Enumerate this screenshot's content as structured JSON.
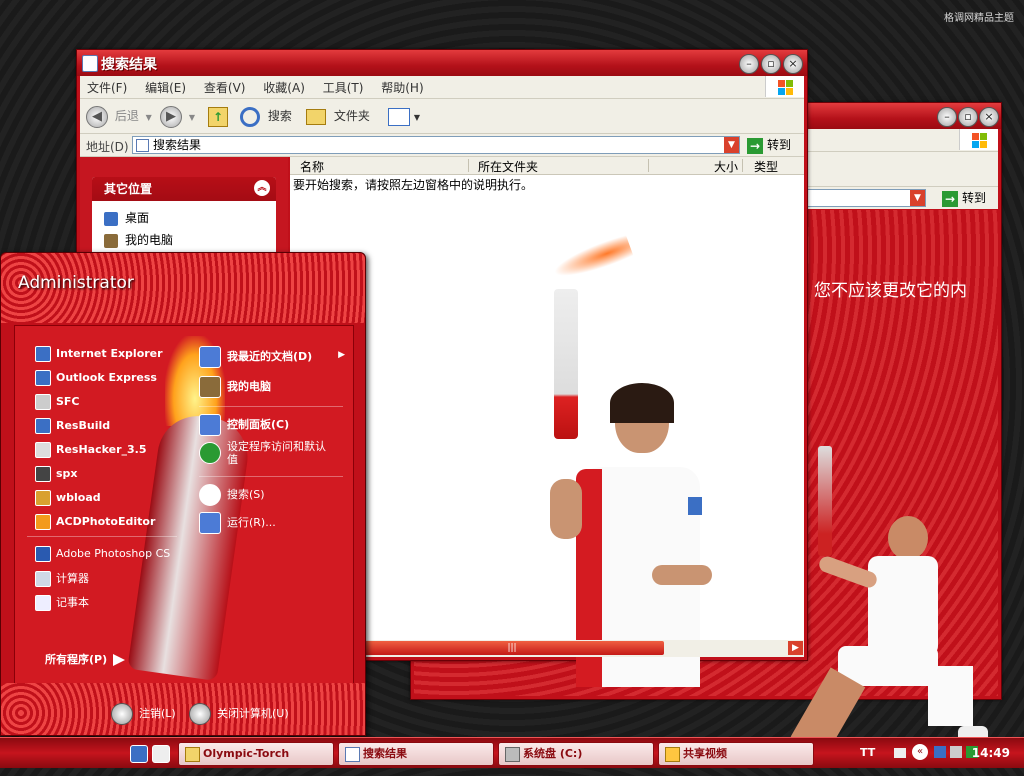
{
  "desktop": {
    "brand": "格调网精品主题"
  },
  "win_main": {
    "title": "搜索结果",
    "menus": [
      "文件(F)",
      "编辑(E)",
      "查看(V)",
      "收藏(A)",
      "工具(T)",
      "帮助(H)"
    ],
    "toolbar": {
      "back": "后退",
      "search": "搜索",
      "folders": "文件夹"
    },
    "address_label": "地址(D)",
    "address_value": "搜索结果",
    "go": "转到",
    "panel_title": "其它位置",
    "panel_items": [
      "桌面",
      "我的电脑"
    ],
    "columns": [
      "名称",
      "所在文件夹",
      "大小",
      "类型"
    ],
    "hint": "要开始搜索，请按照左边窗格中的说明执行。"
  },
  "win_back": {
    "go": "转到",
    "partial_text": "您不应该更改它的内"
  },
  "start_menu": {
    "user": "Administrator",
    "left_items": [
      {
        "label": "Internet Explorer",
        "icon": "ie-icon"
      },
      {
        "label": "Outlook Express",
        "icon": "outlook-icon"
      },
      {
        "label": "SFC",
        "icon": "sfc-icon"
      },
      {
        "label": "ResBuild",
        "icon": "resbuild-icon"
      },
      {
        "label": "ResHacker_3.5",
        "icon": "reshacker-icon"
      },
      {
        "label": "spx",
        "icon": "spx-icon"
      },
      {
        "label": "wbload",
        "icon": "wbload-icon"
      },
      {
        "label": "ACDPhotoEditor",
        "icon": "acd-icon"
      },
      {
        "label": "Adobe Photoshop CS",
        "icon": "photoshop-icon"
      },
      {
        "label": "计算器",
        "icon": "calculator-icon"
      },
      {
        "label": "记事本",
        "icon": "notepad-icon"
      }
    ],
    "all_programs": "所有程序(P)",
    "right_items": [
      {
        "label": "我最近的文档(D)",
        "icon": "recent-docs-icon"
      },
      {
        "label": "我的电脑",
        "icon": "my-computer-icon"
      },
      {
        "label": "控制面板(C)",
        "icon": "control-panel-icon"
      },
      {
        "label": "设定程序访问和默认值",
        "icon": "program-access-icon"
      },
      {
        "label": "搜索(S)",
        "icon": "search-icon"
      },
      {
        "label": "运行(R)...",
        "icon": "run-icon"
      }
    ],
    "logoff": "注销(L)",
    "shutdown": "关闭计算机(U)"
  },
  "taskbar": {
    "tasks": [
      "Olympic-Torch",
      "搜索结果",
      "系统盘 (C:)",
      "共享视频"
    ],
    "lang": "TT",
    "clock": "14:49"
  },
  "colors": {
    "accent": "#c0101a",
    "dark": "#8a0a10"
  }
}
